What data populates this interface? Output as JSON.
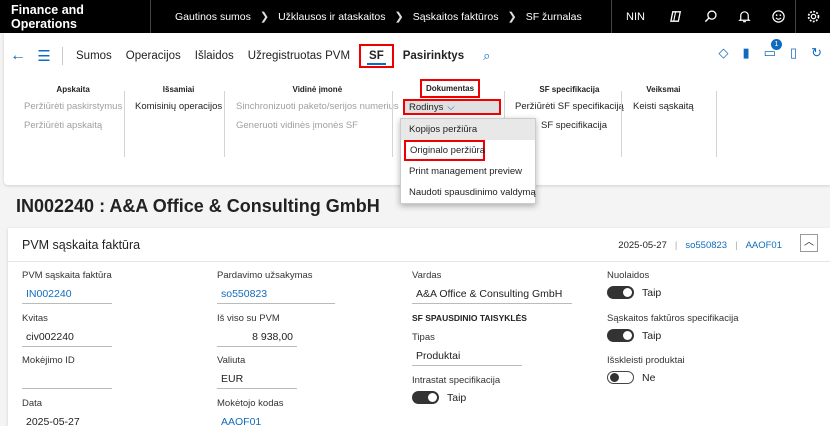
{
  "topbar": {
    "app_title": "Finance and Operations",
    "breadcrumbs": [
      "Gautinos sumos",
      "Užklausos ir ataskaitos",
      "Sąskaitos faktūros",
      "SF žurnalas"
    ],
    "company": "NIN",
    "icons": [
      "connected-icon",
      "search-icon",
      "bell-icon",
      "smiley-icon",
      "gear-icon"
    ]
  },
  "actionpane": {
    "tabs": [
      "Sumos",
      "Operacijos",
      "Išlaidos",
      "Užregistruotas PVM",
      "SF",
      "Pasirinktys"
    ],
    "active_tab": "SF",
    "badge_count": "1",
    "groups": {
      "apskaita": {
        "title": "Apskaita",
        "items": [
          "Peržiūrėti paskirstymus",
          "Peržiūrėti apskaitą"
        ]
      },
      "issamiai": {
        "title": "Išsamiai",
        "items": [
          "Komisinių operacijos"
        ]
      },
      "vidine": {
        "title": "Vidinė įmonė",
        "items": [
          "Sinchronizuoti paketo/serijos numerius",
          "Generuoti vidinės įmonės SF"
        ]
      },
      "dokumentas": {
        "title": "Dokumentas",
        "rodinys": "Rodinys"
      },
      "sf_spec": {
        "title": "SF specifikacija",
        "items": [
          "Peržiūrėti SF specifikaciją",
          "SF specifikacija"
        ]
      },
      "veiksmai": {
        "title": "Veiksmai",
        "items": [
          "Keisti sąskaitą"
        ]
      }
    },
    "dropdown": [
      "Kopijos peržiūra",
      "Originalo peržiūra",
      "Print management preview",
      "Naudoti spausdinimo valdymą"
    ]
  },
  "record": {
    "title": "IN002240 : A&A Office & Consulting GmbH"
  },
  "fasttab": {
    "title": "PVM sąskaita faktūra",
    "summary": [
      "2025-05-27",
      "so550823",
      "AAOF01"
    ],
    "fields": {
      "pvm_sf_label": "PVM sąskaita faktūra",
      "pvm_sf_value": "IN002240",
      "kvitas_label": "Kvitas",
      "kvitas_value": "civ002240",
      "mokejimo_label": "Mokėjimo ID",
      "mokejimo_value": "",
      "data_label": "Data",
      "data_value": "2025-05-27",
      "pardavimo_label": "Pardavimo užsakymas",
      "pardavimo_value": "so550823",
      "isviso_label": "Iš viso su PVM",
      "isviso_value": "8 938,00",
      "valiuta_label": "Valiuta",
      "valiuta_value": "EUR",
      "moketojo_label": "Mokėtojo kodas",
      "moketojo_value": "AAOF01",
      "vardas_label": "Vardas",
      "vardas_value": "A&A Office & Consulting GmbH",
      "print_rules_head": "SF SPAUSDINIO TAISYKLĖS",
      "tipas_label": "Tipas",
      "tipas_value": "Produktai",
      "intrastat_label": "Intrastat specifikacija",
      "intrastat_value": "Taip",
      "nuolaidos_label": "Nuolaidos",
      "nuolaidos_value": "Taip",
      "sf_spec_label": "Sąskaitos faktūros specifikacija",
      "sf_spec_value": "Taip",
      "isskleisti_label": "Išskleisti produktai",
      "isskleisti_value": "Ne"
    }
  }
}
